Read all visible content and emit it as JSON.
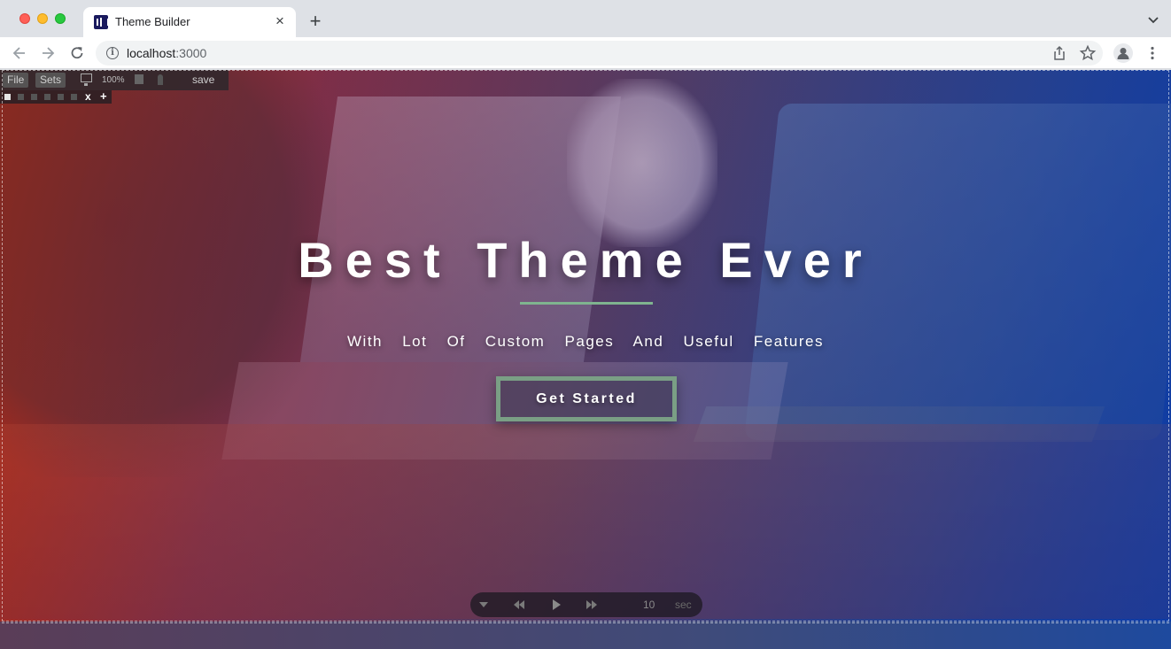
{
  "browser": {
    "tab_title": "Theme Builder",
    "url_host": "localhost",
    "url_port": ":3000"
  },
  "editor": {
    "menu": [
      "File",
      "Sets"
    ],
    "zoom": "100%",
    "save_label": "save",
    "swatch_count": 6,
    "remove_label": "x",
    "add_label": "+"
  },
  "hero": {
    "title": "Best Theme Ever",
    "subtitle": "With Lot Of Custom Pages And Useful Features",
    "cta_label": "Get Started",
    "accent_color": "#7fb48f"
  },
  "slider": {
    "duration": "10",
    "unit": "sec"
  }
}
